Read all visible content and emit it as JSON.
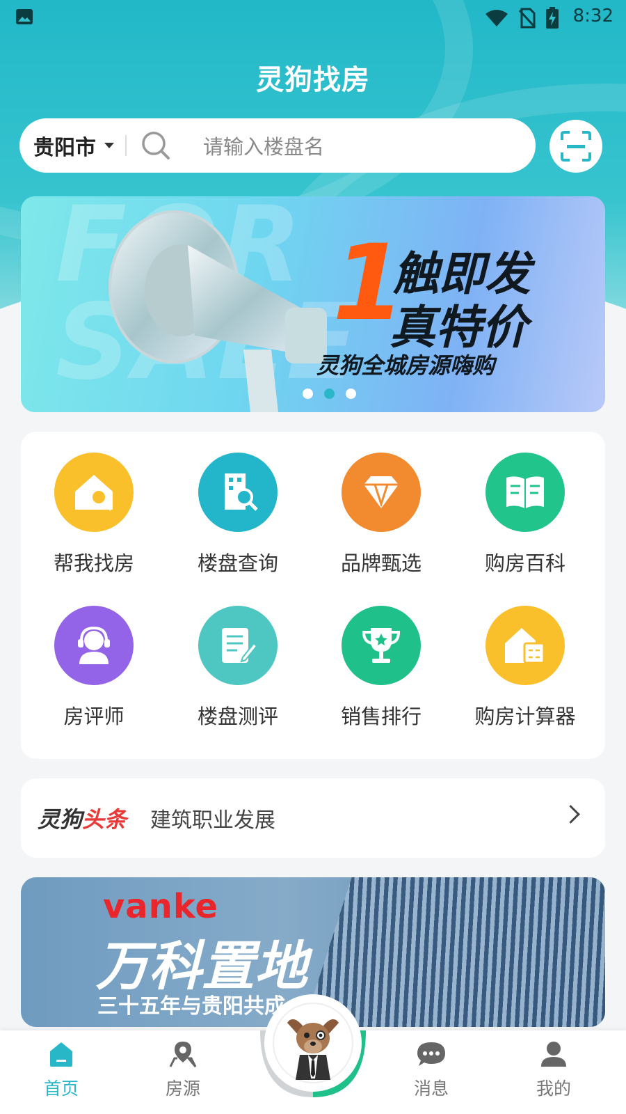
{
  "status_bar": {
    "time": "8:32"
  },
  "app": {
    "title": "灵狗找房"
  },
  "search": {
    "city": "贵阳市",
    "placeholder": "请输入楼盘名"
  },
  "banner": {
    "bg_text": "FOR SALE",
    "number": "1",
    "line1": "触即发",
    "line2": "真特价",
    "subtitle": "灵狗全城房源嗨购",
    "slide_count": 3,
    "active_slide": 2
  },
  "menu": {
    "items": [
      {
        "label": "帮我找房",
        "icon": "house-search-icon",
        "color": "#f9c02c"
      },
      {
        "label": "楼盘查询",
        "icon": "building-search-icon",
        "color": "#23b5c9"
      },
      {
        "label": "品牌甄选",
        "icon": "diamond-icon",
        "color": "#f28a30"
      },
      {
        "label": "购房百科",
        "icon": "book-icon",
        "color": "#21c48a"
      },
      {
        "label": "房评师",
        "icon": "headset-person-icon",
        "color": "#9464e8"
      },
      {
        "label": "楼盘测评",
        "icon": "document-edit-icon",
        "color": "#4ec7c2"
      },
      {
        "label": "销售排行",
        "icon": "trophy-icon",
        "color": "#1fc08a"
      },
      {
        "label": "购房计算器",
        "icon": "house-calculator-icon",
        "color": "#f9c02c"
      }
    ]
  },
  "news": {
    "logo_main": "灵狗",
    "logo_accent": "头条",
    "headline": "建筑职业发展"
  },
  "ad": {
    "brand": "vanke",
    "title": "万科置地",
    "subtitle": "三十五年与贵阳共成"
  },
  "tabbar": {
    "items": [
      {
        "label": "首页",
        "icon": "home-icon"
      },
      {
        "label": "房源",
        "icon": "map-pin-icon"
      },
      {
        "label": "消息",
        "icon": "chat-icon"
      },
      {
        "label": "我的",
        "icon": "person-icon"
      }
    ],
    "active": "首页",
    "accent": "#27b7c7"
  }
}
